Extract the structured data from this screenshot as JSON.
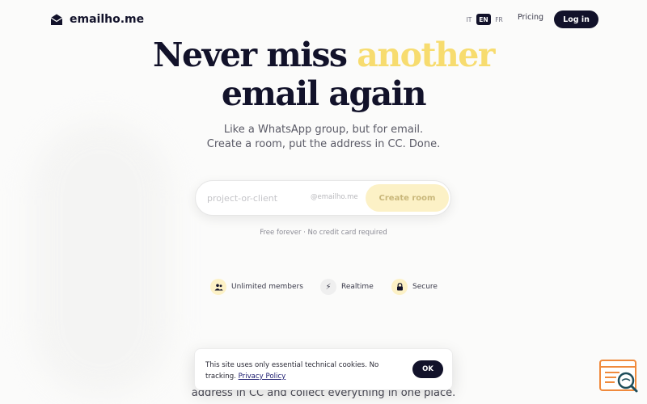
{
  "header": {
    "brand": "emailho.me",
    "languages": [
      "IT",
      "EN",
      "FR"
    ],
    "active_language": "EN",
    "pricing_label": "Pricing",
    "login_label": "Log in"
  },
  "hero": {
    "title_part1": "Never miss ",
    "title_highlight": "another",
    "title_line2": "email again",
    "subtitle_line1": "Like a WhatsApp group, but for email.",
    "subtitle_line2": "Create a room, put the address in CC. Done."
  },
  "form": {
    "room_placeholder": "project-or-client",
    "domain_suffix": "@emailho.me",
    "create_label": "Create room",
    "note": "Free forever · No credit card required"
  },
  "features": [
    {
      "icon": "people-icon",
      "label": "Unlimited members"
    },
    {
      "icon": "lightning-icon",
      "label": "Realtime"
    },
    {
      "icon": "lock-icon",
      "label": "Secure"
    }
  ],
  "section": {
    "heading": "",
    "text": "address in CC and collect everything in one place."
  },
  "cookie": {
    "text": "This site uses only essential technical cookies. No tracking. ",
    "link_label": "Privacy Policy",
    "ok_label": "OK"
  },
  "colors": {
    "primary": "#12122a",
    "accent": "#f7dc6f",
    "accent_soft": "#fcf1c6"
  }
}
